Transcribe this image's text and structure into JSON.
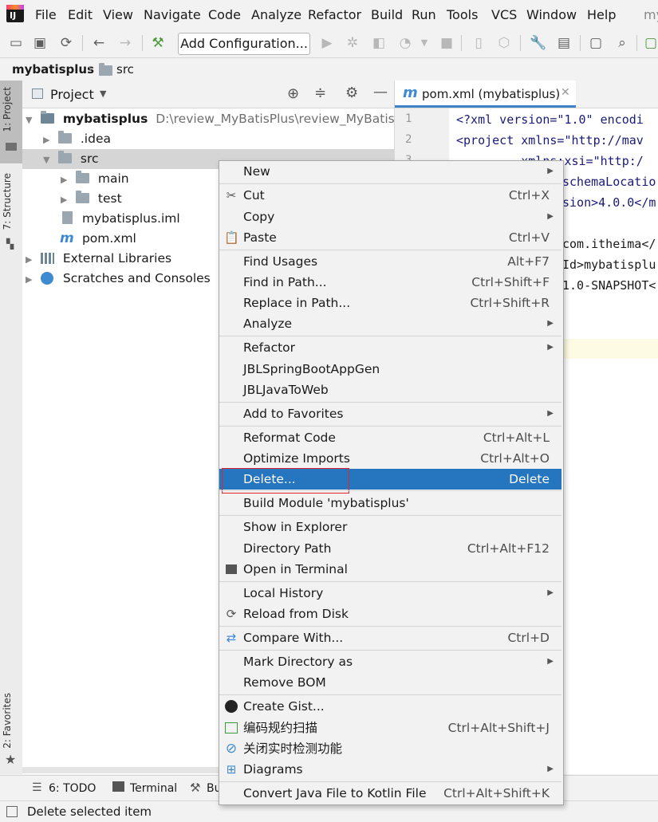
{
  "menubar": [
    "File",
    "Edit",
    "View",
    "Navigate",
    "Code",
    "Analyze",
    "Refactor",
    "Build",
    "Run",
    "Tools",
    "VCS",
    "Window",
    "Help",
    "my"
  ],
  "toolbar": {
    "add_configuration": "Add Configuration..."
  },
  "breadcrumb": [
    "mybatisplus",
    "src"
  ],
  "side_tabs": {
    "project": "1: Project",
    "structure": "7: Structure",
    "favorites": "2: Favorites"
  },
  "project_panel": {
    "title": "Project",
    "tree": {
      "root_name": "mybatisplus",
      "root_path": "D:\\review_MyBatisPlus\\review_MyBatisPlus_i",
      "idea": ".idea",
      "src": "src",
      "main": "main",
      "test": "test",
      "iml": "mybatisplus.iml",
      "pom": "pom.xml",
      "ext_libs": "External Libraries",
      "scratches": "Scratches and Consoles"
    }
  },
  "editor": {
    "tab_label": "pom.xml (mybatisplus)",
    "lines": [
      {
        "n": "1",
        "text": "<?xml version=\"1.0\" encodi"
      },
      {
        "n": "2",
        "text": "<project xmlns=\"http://mav"
      },
      {
        "n": "3",
        "text": "         xmlns:xsi=\"http:/"
      },
      {
        "n": "",
        "text": "schemaLocatio"
      },
      {
        "n": "",
        "text": "sion>4.0.0</m"
      },
      {
        "n": "",
        "text": "com.itheima</"
      },
      {
        "n": "",
        "text": "Id>mybatisplu"
      },
      {
        "n": "",
        "text": "1.0-SNAPSHOT<"
      }
    ]
  },
  "context_menu": {
    "new": "New",
    "cut": "Cut",
    "cut_sc": "Ctrl+X",
    "copy": "Copy",
    "paste": "Paste",
    "paste_sc": "Ctrl+V",
    "find_usages": "Find Usages",
    "find_usages_sc": "Alt+F7",
    "find_in_path": "Find in Path...",
    "find_in_path_sc": "Ctrl+Shift+F",
    "replace_in_path": "Replace in Path...",
    "replace_in_path_sc": "Ctrl+Shift+R",
    "analyze": "Analyze",
    "refactor": "Refactor",
    "jbl_spring": "JBLSpringBootAppGen",
    "jbl_java": "JBLJavaToWeb",
    "add_favorites": "Add to Favorites",
    "reformat": "Reformat Code",
    "reformat_sc": "Ctrl+Alt+L",
    "optimize": "Optimize Imports",
    "optimize_sc": "Ctrl+Alt+O",
    "delete": "Delete...",
    "delete_sc": "Delete",
    "build_module": "Build Module 'mybatisplus'",
    "show_explorer": "Show in Explorer",
    "dir_path": "Directory Path",
    "dir_path_sc": "Ctrl+Alt+F12",
    "open_terminal": "Open in Terminal",
    "local_history": "Local History",
    "reload": "Reload from Disk",
    "compare": "Compare With...",
    "compare_sc": "Ctrl+D",
    "mark_dir": "Mark Directory as",
    "remove_bom": "Remove BOM",
    "gist": "Create Gist...",
    "code_scan": "编码规约扫描",
    "code_scan_sc": "Ctrl+Alt+Shift+J",
    "close_detect": "关闭实时检测功能",
    "diagrams": "Diagrams",
    "convert_kotlin": "Convert Java File to Kotlin File",
    "convert_kotlin_sc": "Ctrl+Alt+Shift+K"
  },
  "bottom_tabs": {
    "todo": "6: TODO",
    "terminal": "Terminal",
    "build": "Bu"
  },
  "status": "Delete selected item"
}
